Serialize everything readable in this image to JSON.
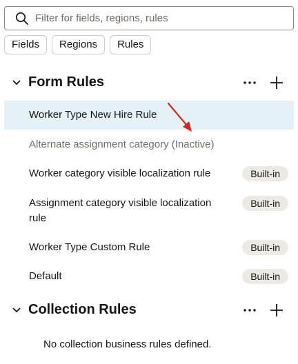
{
  "search": {
    "placeholder": "Filter for fields, regions, rules",
    "value": ""
  },
  "filters": [
    "Fields",
    "Regions",
    "Rules"
  ],
  "form_rules": {
    "title": "Form Rules",
    "items": [
      {
        "label": "Worker Type New Hire Rule",
        "badge": "",
        "state": "selected"
      },
      {
        "label": "Alternate assignment category (Inactive)",
        "badge": "",
        "state": "inactive"
      },
      {
        "label": "Worker category visible localization rule",
        "badge": "Built-in",
        "state": "normal"
      },
      {
        "label_line1": "Assignment category visible localization",
        "label_line2": "rule",
        "badge": "Built-in",
        "state": "normal"
      },
      {
        "label": "Worker Type Custom Rule",
        "badge": "Built-in",
        "state": "normal"
      },
      {
        "label": "Default",
        "badge": "Built-in",
        "state": "normal"
      }
    ]
  },
  "collection_rules": {
    "title": "Collection Rules",
    "empty_message": "No collection business rules defined."
  },
  "colors": {
    "selected_row": "#e4f1f7",
    "badge_bg": "#edeae6",
    "annotation_arrow": "#e0201b"
  },
  "icons": [
    "search-icon",
    "chevron-down-icon",
    "more-icon",
    "plus-icon",
    "annotation-arrow"
  ]
}
